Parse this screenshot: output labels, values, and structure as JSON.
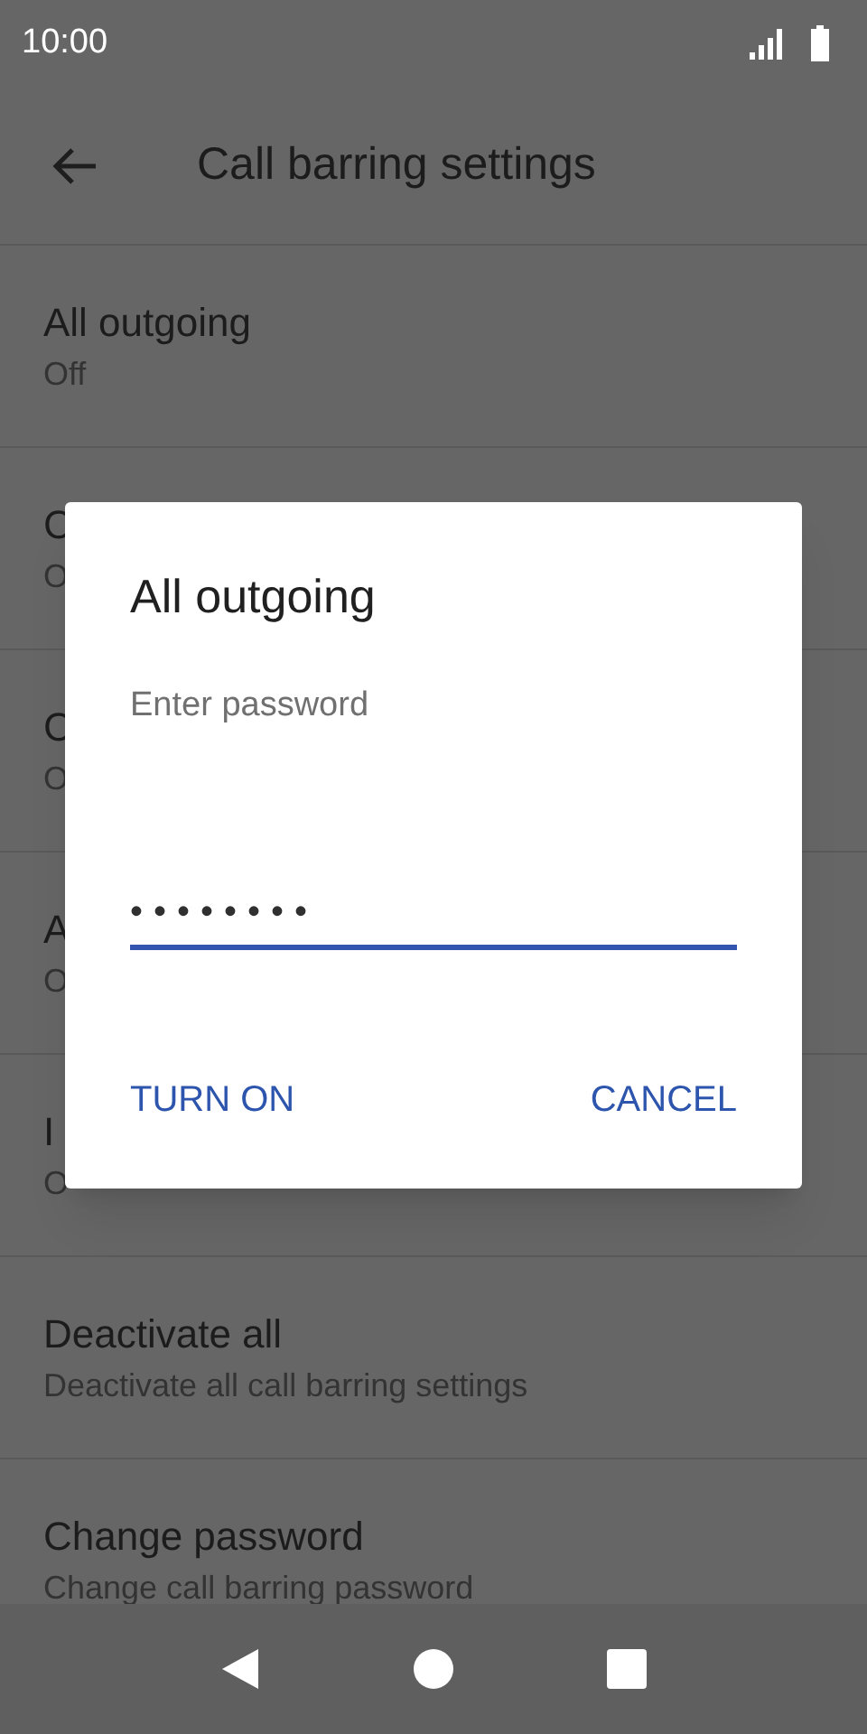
{
  "status_bar": {
    "time": "10:00"
  },
  "app_bar": {
    "title": "Call barring settings"
  },
  "settings": [
    {
      "title": "All outgoing",
      "summary": "Off"
    },
    {
      "title": "C",
      "summary": "O"
    },
    {
      "title": "C",
      "summary": "O"
    },
    {
      "title": "A",
      "summary": "O"
    },
    {
      "title": "I",
      "summary": "O"
    },
    {
      "title": "Deactivate all",
      "summary": "Deactivate all call barring settings"
    },
    {
      "title": "Change password",
      "summary": "Change call barring password"
    }
  ],
  "dialog": {
    "title": "All outgoing",
    "label": "Enter password",
    "value": "••••••••",
    "buttons": [
      "TURN ON",
      "CANCEL"
    ]
  }
}
